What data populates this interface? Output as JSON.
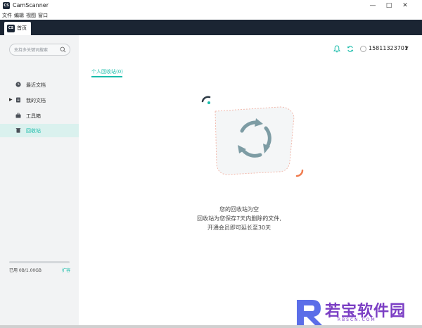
{
  "window": {
    "title": "CamScanner",
    "app_icon_text": "CS",
    "controls": {
      "minimize": "—",
      "maximize": "□",
      "close": "✕"
    }
  },
  "menu": [
    "文件",
    "编辑",
    "视图",
    "窗口"
  ],
  "tab": {
    "icon_text": "CS",
    "label": "首页"
  },
  "sidebar": {
    "search_placeholder": "支持多关键词搜索",
    "items": [
      {
        "label": "最近文档",
        "icon": "clock-icon"
      },
      {
        "label": "我的文档",
        "icon": "document-icon",
        "expandable": true
      },
      {
        "label": "工具箱",
        "icon": "toolbox-icon"
      },
      {
        "label": "回收站",
        "icon": "trash-icon",
        "active": true
      }
    ],
    "storage": {
      "text": "已用 0B/1.00GB",
      "expand_label": "扩容",
      "used_fraction": 0.0
    }
  },
  "header": {
    "user_phone": "15811323701",
    "icons": [
      "bell-icon",
      "sync-icon"
    ]
  },
  "main": {
    "sub_tab": "个人回收站(0)",
    "empty": {
      "title": "您的回收站为空",
      "line1": "回收站为您保存7天内删除的文件,",
      "line2": "开通会员即可延长至30天"
    }
  },
  "watermark": {
    "text": "若宝软件园",
    "url": "RBSCN.COM"
  },
  "colors": {
    "accent": "#19bcaa",
    "tabbar": "#1b2533",
    "sidebar": "#f2f3f4"
  }
}
